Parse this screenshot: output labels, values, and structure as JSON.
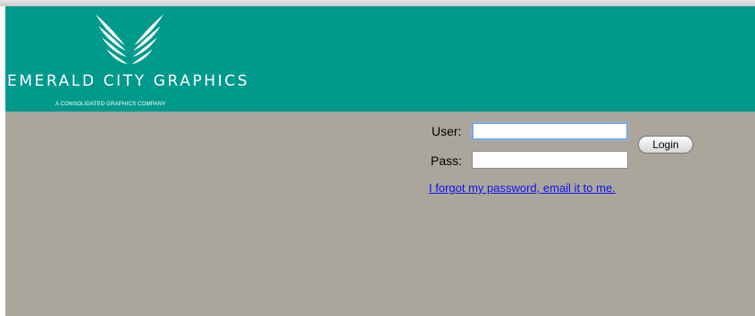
{
  "header": {
    "brand_name": "EMERALD CITY GRAPHICS",
    "tagline": "A CONSOLIDATED GRAPHICS COMPANY",
    "logo_icon": "wings-logo-icon",
    "background_color": "#009a8c"
  },
  "login": {
    "user_label": "User:",
    "user_value": "",
    "pass_label": "Pass:",
    "pass_value": "",
    "button_label": "Login",
    "forgot_link": "I forgot my password, email it to me.",
    "link_color": "#1010ee"
  },
  "content": {
    "background_color": "#aaa69b"
  }
}
